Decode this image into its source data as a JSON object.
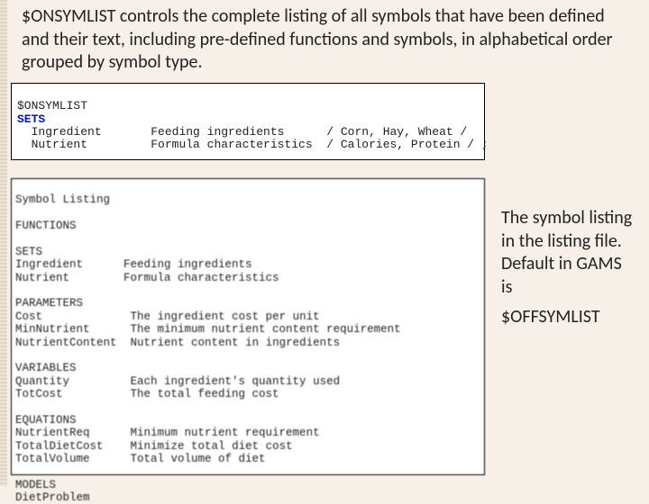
{
  "top": {
    "lead": "$ONSYMLIST",
    "body": " controls the complete listing of all symbols that have been defined and their text, including pre-defined functions and symbols, in alphabetical order grouped by symbol type."
  },
  "box1": {
    "l1": "$ONSYMLIST",
    "l2kw": "SETS",
    "l3a": "  Ingredient",
    "l3b": "Feeding ingredients",
    "l3c": "/ Corn, Hay, Wheat /",
    "l4a": "  Nutrient",
    "l4b": "Formula characteristics",
    "l4c": "/ Calories, Protein / ;"
  },
  "box2": {
    "title": "Symbol Listing",
    "s1h": "FUNCTIONS",
    "s2h": "SETS",
    "s2a_l": "Ingredient",
    "s2a_r": "Feeding ingredients",
    "s2b_l": "Nutrient",
    "s2b_r": "Formula characteristics",
    "s3h": "PARAMETERS",
    "s3a_l": "Cost",
    "s3a_r": "The ingredient cost per unit",
    "s3b_l": "MinNutrient",
    "s3b_r": "The minimum nutrient content requirement",
    "s3c_l": "NutrientContent",
    "s3c_r": "Nutrient content in ingredients",
    "s4h": "VARIABLES",
    "s4a_l": "Quantity",
    "s4a_r": "Each ingredient's quantity used",
    "s4b_l": "TotCost",
    "s4b_r": "The total feeding cost",
    "s5h": "EQUATIONS",
    "s5a_l": "NutrientReq",
    "s5a_r": "Minimum nutrient requirement",
    "s5b_l": "TotalDietCost",
    "s5b_r": "Minimize total diet cost",
    "s5c_l": "TotalVolume",
    "s5c_r": "Total volume of diet",
    "s6h": "MODELS",
    "s6a_l": "DietProblem"
  },
  "right": {
    "body": "The symbol listing in the listing file. Default in GAMS is",
    "kw": "$OFFSYMLIST"
  }
}
